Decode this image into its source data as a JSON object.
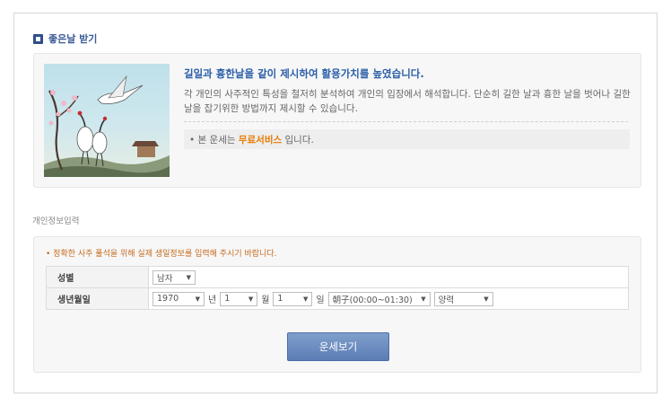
{
  "section": {
    "title": "좋은날 받기"
  },
  "intro": {
    "headline": "길일과 흉한날을 같이 제시하여 활용가치를 높였습니다.",
    "description": "각 개인의 사주적인 특성을 철저히 분석하여 개인의 입장에서 해석합니다. 단순히 길한 날과 흉한 날을 벗어나 길한 날을 잡기위한 방법까지 제시할 수 있습니다.",
    "service_prefix": "• 본 운세는",
    "service_highlight": "무료서비스",
    "service_suffix": "입니다.",
    "image": "crane-landscape-illustration"
  },
  "form": {
    "section_label": "개인정보입력",
    "notice": "• 정확한 사주 풀석을 위해 실제 생일정보를 입력해 주시기 바랍니다.",
    "gender": {
      "label": "성별",
      "value": "남자"
    },
    "birth": {
      "label": "생년월일",
      "year": "1970",
      "year_unit": "년",
      "month": "1",
      "month_unit": "월",
      "day": "1",
      "day_unit": "일",
      "time": "朝子(00:00~01:30)",
      "calendar": "양력"
    },
    "submit_label": "운세보기"
  },
  "colors": {
    "accent": "#2b5fa8",
    "highlight": "#e87a00",
    "button": "#6a8cc0"
  }
}
